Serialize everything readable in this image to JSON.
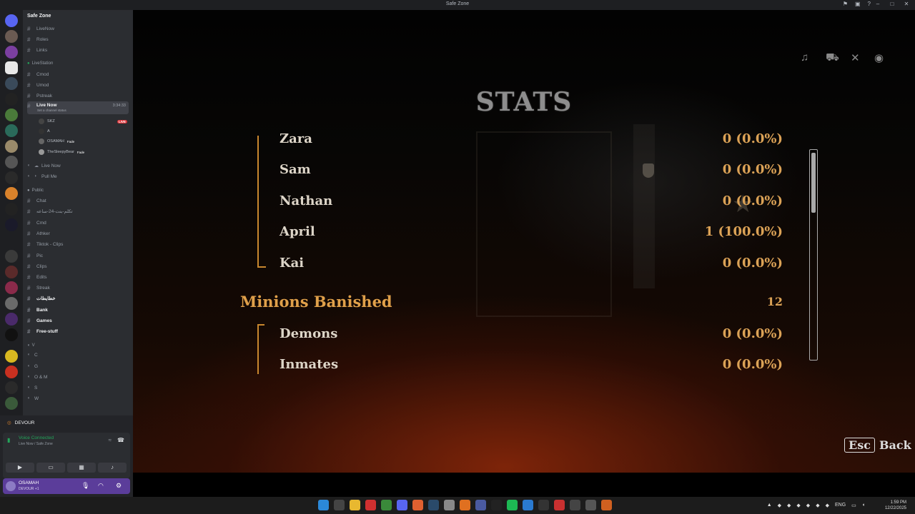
{
  "window": {
    "title": "Safe Zone"
  },
  "server": {
    "name": "Safe Zone"
  },
  "channels": {
    "top": [
      "LiveNow",
      "Roles",
      "Links"
    ],
    "livestation_category": "LiveStation",
    "livestation": [
      "Cmod",
      "Umod",
      "Pstreak"
    ],
    "live_now_channel": {
      "name": "Live Now",
      "timer": "3:34:33",
      "status": "Set a channel status"
    },
    "voice_users": [
      {
        "name": "SKZ",
        "badge": "LIVE"
      },
      {
        "name": "A",
        "badge": ""
      },
      {
        "name": "OSAMAH",
        "badge": "Fade"
      },
      {
        "name": "TheSleepyBear",
        "badge": "Fade"
      }
    ],
    "voice_channels": [
      "Live Now",
      "Pull Me"
    ],
    "public_category": "Public",
    "public": [
      "Chat",
      "تكلم-بنت-24-ساعه",
      "Cmd",
      "Athker",
      "Tiktok - Clips",
      "Pic",
      "Clips",
      "Edits",
      "Streak",
      "خطايطات",
      "Bank",
      "Games",
      "Free-stuff"
    ],
    "v_category": "V",
    "v_channels": [
      "C",
      "G",
      "O & M",
      "S",
      "W"
    ]
  },
  "panel": {
    "activity": "DEVOUR",
    "voice_status": "Voice Connected",
    "voice_location": "Live Now / Safe Zone",
    "user": {
      "name": "OSAMAH",
      "status": "DEVOUR +1"
    }
  },
  "game": {
    "title": "STATS",
    "rows": [
      {
        "name": "Zara",
        "value": "0 (0.0%)"
      },
      {
        "name": "Sam",
        "value": "0 (0.0%)"
      },
      {
        "name": "Nathan",
        "value": "0 (0.0%)"
      },
      {
        "name": "April",
        "value": "1 (100.0%)"
      },
      {
        "name": "Kai",
        "value": "0 (0.0%)"
      }
    ],
    "category": {
      "name": "Minions Banished",
      "value": "12"
    },
    "sub_rows": [
      {
        "name": "Demons",
        "value": "0 (0.0%)"
      },
      {
        "name": "Inmates",
        "value": "0 (0.0%)"
      }
    ],
    "back_key": "Esc",
    "back_label": "Back",
    "scroll_position_pct": 5
  },
  "taskbar": {
    "lang": "ENG",
    "time": "1:59 PM",
    "date": "12/22/2025"
  }
}
